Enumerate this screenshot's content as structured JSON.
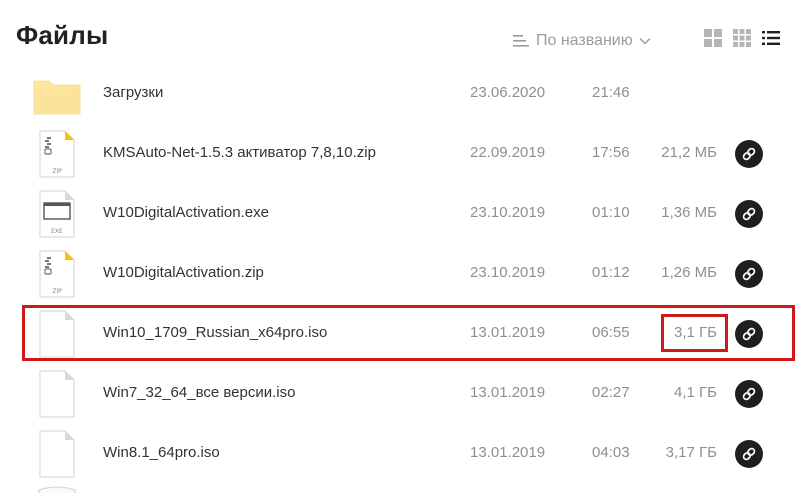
{
  "header": {
    "title": "Файлы",
    "sort_label": "По названию"
  },
  "icons": {
    "sort": "sort-lines-icon",
    "sort_chevron": "chevron-down-icon",
    "view_tiles_large": "grid-large-icon",
    "view_tiles_small": "grid-small-icon",
    "view_list": "list-icon",
    "share": "link-icon"
  },
  "colors": {
    "highlight": "#cc1a1a",
    "folder": "#fde7a0",
    "zip_accent": "#f5c400"
  },
  "files": [
    {
      "name": "Загрузки",
      "date": "23.06.2020",
      "time": "21:46",
      "size": "",
      "type": "folder",
      "icon_label": ""
    },
    {
      "name": "KMSAuto-Net-1.5.3 активатор 7,8,10.zip",
      "date": "22.09.2019",
      "time": "17:56",
      "size": "21,2 МБ",
      "type": "zip",
      "icon_label": "ZIP"
    },
    {
      "name": "W10DigitalActivation.exe",
      "date": "23.10.2019",
      "time": "01:10",
      "size": "1,36 МБ",
      "type": "exe",
      "icon_label": "EXE"
    },
    {
      "name": "W10DigitalActivation.zip",
      "date": "23.10.2019",
      "time": "01:12",
      "size": "1,26 МБ",
      "type": "zip",
      "icon_label": "ZIP"
    },
    {
      "name": "Win10_1709_Russian_x64pro.iso",
      "date": "13.01.2019",
      "time": "06:55",
      "size": "3,1 ГБ",
      "type": "iso",
      "icon_label": ""
    },
    {
      "name": "Win7_32_64_все версии.iso",
      "date": "13.01.2019",
      "time": "02:27",
      "size": "4,1 ГБ",
      "type": "iso",
      "icon_label": ""
    },
    {
      "name": "Win8.1_64pro.iso",
      "date": "13.01.2019",
      "time": "04:03",
      "size": "3,17 ГБ",
      "type": "iso",
      "icon_label": ""
    }
  ]
}
